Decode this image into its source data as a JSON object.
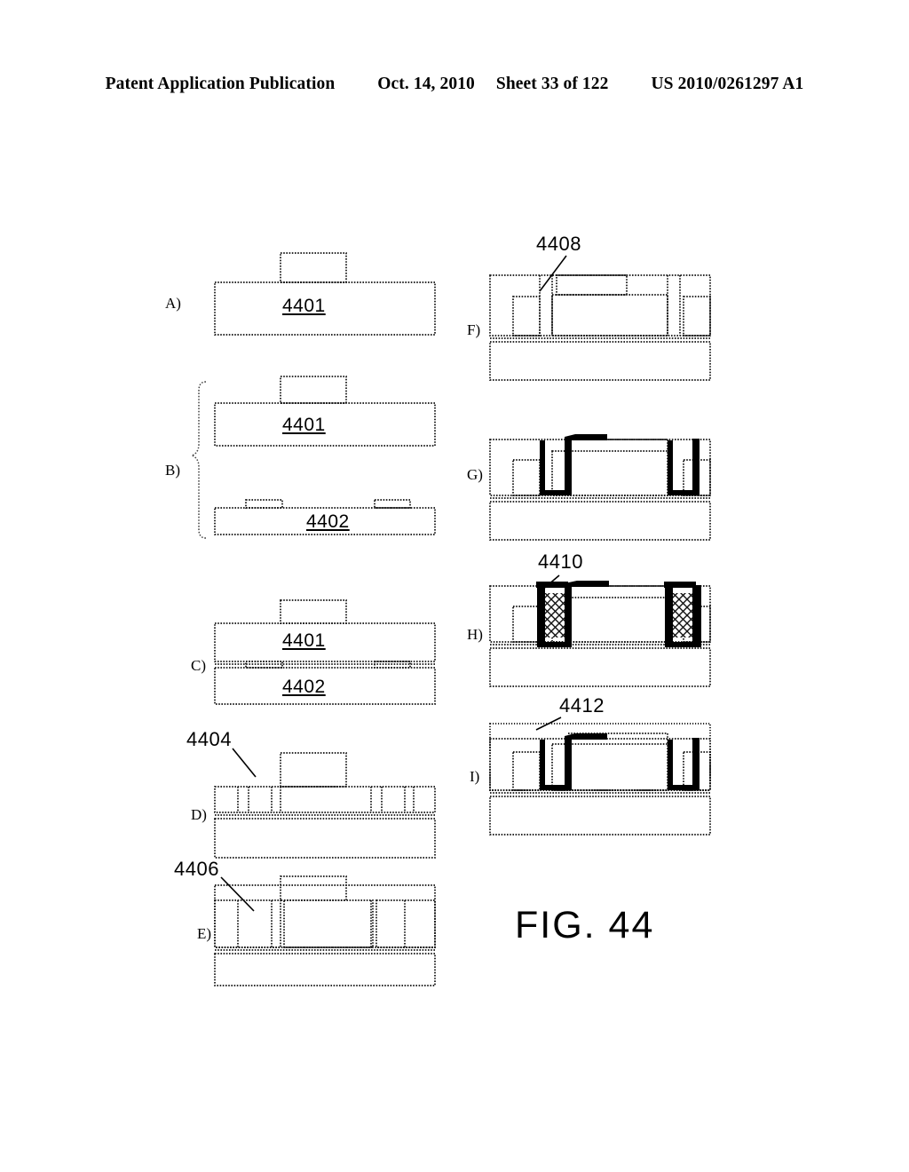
{
  "header": {
    "publication": "Patent Application Publication",
    "date": "Oct. 14, 2010",
    "sheet": "Sheet 33 of 122",
    "patent_number": "US 2010/0261297 A1"
  },
  "figure": {
    "caption": "FIG. 44",
    "panels": [
      {
        "id": "A",
        "label": "A)",
        "description": "Starting substrate 4401 with raised feature on top surface"
      },
      {
        "id": "B",
        "label": "B)",
        "description": "Substrate 4401 aligned above carrier wafer 4402 having two bond pads"
      },
      {
        "id": "C",
        "label": "C)",
        "description": "Substrate 4401 bonded onto carrier 4402"
      },
      {
        "id": "D",
        "label": "D)",
        "description": "Trenches 4404 etched into bonded stack"
      },
      {
        "id": "E",
        "label": "E)",
        "description": "Recess 4406 formed in trench region"
      },
      {
        "id": "F",
        "label": "F)",
        "description": "Layer 4408 deposited over the recessed structure"
      },
      {
        "id": "G",
        "label": "G)",
        "description": "Conformal conductive liner deposited into trenches"
      },
      {
        "id": "H",
        "label": "H)",
        "description": "Trenches filled with material 4410"
      },
      {
        "id": "I",
        "label": "I)",
        "description": "Overlying layer 4412 formed across the structure"
      }
    ],
    "reference_numerals": [
      {
        "ref": "4401",
        "panel": "A",
        "style": "in-block-underlined"
      },
      {
        "ref": "4401",
        "panel": "B",
        "style": "in-block-underlined"
      },
      {
        "ref": "4402",
        "panel": "B",
        "style": "in-block-underlined"
      },
      {
        "ref": "4401",
        "panel": "C",
        "style": "in-block-underlined"
      },
      {
        "ref": "4402",
        "panel": "C",
        "style": "in-block-underlined"
      },
      {
        "ref": "4404",
        "panel": "D",
        "style": "leader-line"
      },
      {
        "ref": "4406",
        "panel": "E",
        "style": "leader-line"
      },
      {
        "ref": "4408",
        "panel": "F",
        "style": "leader-line"
      },
      {
        "ref": "4410",
        "panel": "H",
        "style": "leader-line"
      },
      {
        "ref": "4412",
        "panel": "I",
        "style": "leader-line"
      }
    ]
  },
  "labels": {
    "panel_a": "A)",
    "panel_b": "B)",
    "panel_c": "C)",
    "panel_d": "D)",
    "panel_e": "E)",
    "panel_f": "F)",
    "panel_g": "G)",
    "panel_h": "H)",
    "panel_i": "I)",
    "num_4401_a": "4401",
    "num_4401_b": "4401",
    "num_4402_b": "4402",
    "num_4401_c": "4401",
    "num_4402_c": "4402",
    "num_4404": "4404",
    "num_4406": "4406",
    "num_4408": "4408",
    "num_4410": "4410",
    "num_4412": "4412"
  },
  "colors": {
    "ink": "#000000",
    "paper": "#ffffff",
    "line": "#1a1a1a"
  }
}
